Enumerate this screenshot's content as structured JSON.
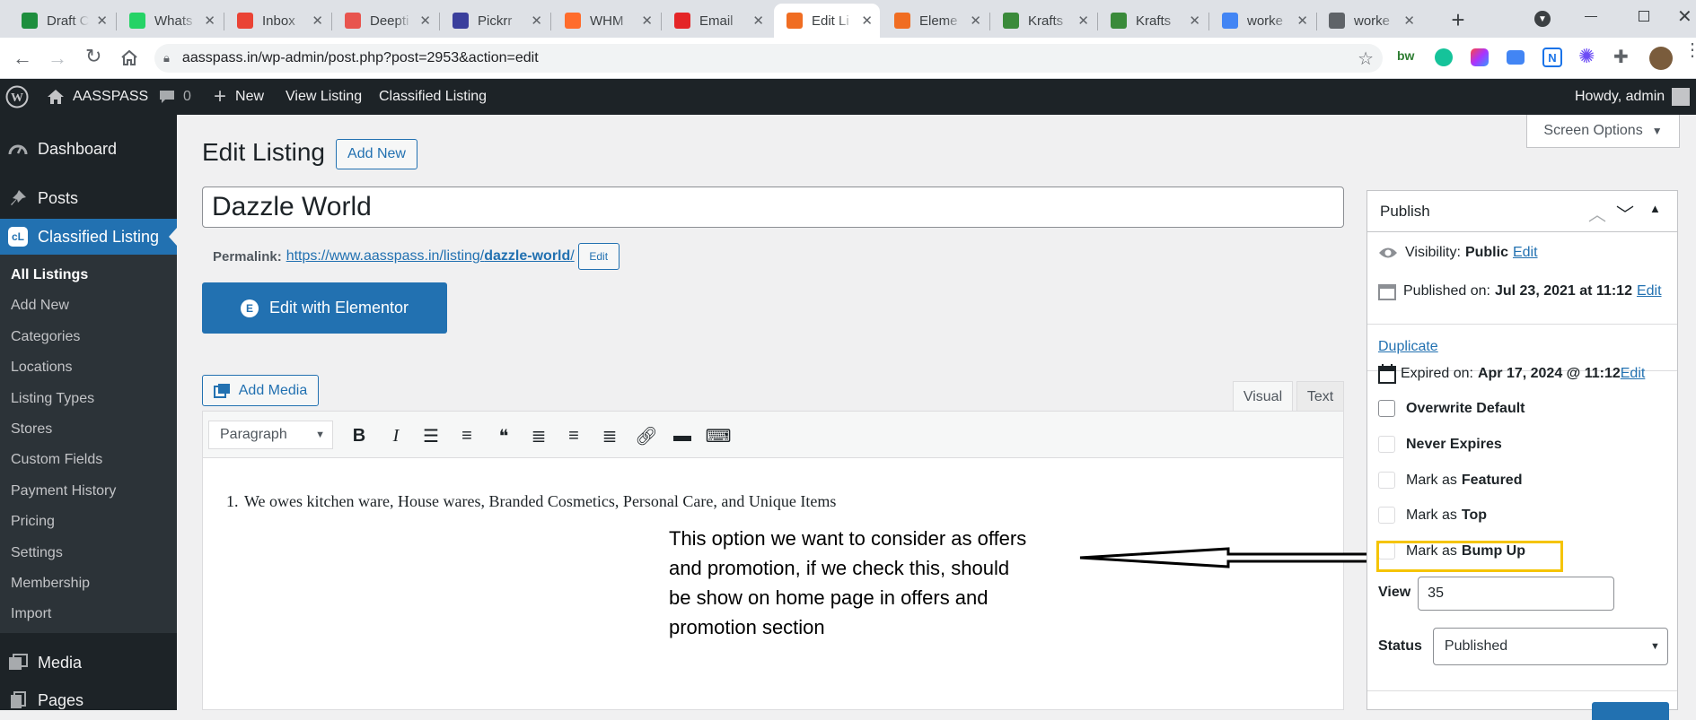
{
  "browser": {
    "tabs": [
      {
        "title": "Draft C",
        "icon": "gmail-drafts-icon",
        "color": "#1e8e3e"
      },
      {
        "title": "Whats",
        "icon": "whatsapp-icon",
        "color": "#25d366"
      },
      {
        "title": "Inbox",
        "icon": "gmail-icon",
        "color": "#ea4335"
      },
      {
        "title": "Deepti",
        "icon": "deepti-icon",
        "color": "#e8544e"
      },
      {
        "title": "Pickrr",
        "icon": "pickrr-icon",
        "color": "#3a3f9c"
      },
      {
        "title": "WHM",
        "icon": "cpanel-icon",
        "color": "#ff6c2c"
      },
      {
        "title": "Email",
        "icon": "zoho-icon",
        "color": "#e42527"
      },
      {
        "title": "Edit Li",
        "icon": "elementor-a-icon",
        "color": "#f06d22"
      },
      {
        "title": "Eleme",
        "icon": "elementor-a-icon",
        "color": "#f06d22"
      },
      {
        "title": "Krafts",
        "icon": "kraftshala-icon",
        "color": "#3a8a3a"
      },
      {
        "title": "Krafts",
        "icon": "kraftshala-icon",
        "color": "#3a8a3a"
      },
      {
        "title": "worke",
        "icon": "google-icon",
        "color": "#4285f4"
      },
      {
        "title": "worke",
        "icon": "globe-icon",
        "color": "#5f6368"
      }
    ],
    "url": "aasspass.in/wp-admin/post.php?post=2953&action=edit"
  },
  "adminbar": {
    "site_name": "AASSPASS",
    "comments_count": "0",
    "new_label": "New",
    "view_listing": "View Listing",
    "classified_listing": "Classified Listing",
    "howdy": "Howdy, admin"
  },
  "sidebar": {
    "dashboard": "Dashboard",
    "posts": "Posts",
    "classified": "Classified Listing",
    "submenu": [
      "All Listings",
      "Add New",
      "Categories",
      "Locations",
      "Listing Types",
      "Stores",
      "Custom Fields",
      "Payment History",
      "Pricing",
      "Settings",
      "Membership",
      "Import"
    ],
    "media": "Media",
    "pages": "Pages"
  },
  "main": {
    "screen_options": "Screen Options",
    "page_title": "Edit Listing",
    "add_new": "Add New",
    "post_title": "Dazzle World",
    "permalink_label": "Permalink:",
    "permalink_url_base": "https://www.aasspass.in/listing/",
    "permalink_slug": "dazzle-world",
    "permalink_url_end": "/",
    "permalink_edit": "Edit",
    "elementor_button": "Edit with Elementor",
    "add_media": "Add Media",
    "tab_visual": "Visual",
    "tab_text": "Text",
    "format_select": "Paragraph",
    "content_list_item": "We owes kitchen ware, House wares, Branded Cosmetics, Personal Care, and Unique Items"
  },
  "annotation": {
    "text_lines": [
      "This option we want to consider as offers",
      "and promotion, if we check this, should",
      "be show on home page in offers and",
      "promotion section"
    ],
    "highlight_color": "#f5c400"
  },
  "publish": {
    "title": "Publish",
    "visibility_label": "Visibility:",
    "visibility_value": "Public",
    "visibility_edit": "Edit",
    "published_label": "Published on:",
    "published_value": "Jul 23, 2021 at 11:12",
    "published_edit": "Edit",
    "duplicate": "Duplicate",
    "expired_label": "Expired on:",
    "expired_value": "Apr 17, 2024 @ 11:12",
    "expired_edit": "Edit",
    "overwrite_default": "Overwrite Default",
    "never_expires": "Never Expires",
    "featured_prefix": "Mark as",
    "featured_label": "Featured",
    "top_prefix": "Mark as",
    "top_label": "Top",
    "bump_prefix": "Mark as",
    "bump_label": "Bump Up",
    "view_label": "View",
    "view_value": "35",
    "status_label": "Status",
    "status_value": "Published"
  }
}
